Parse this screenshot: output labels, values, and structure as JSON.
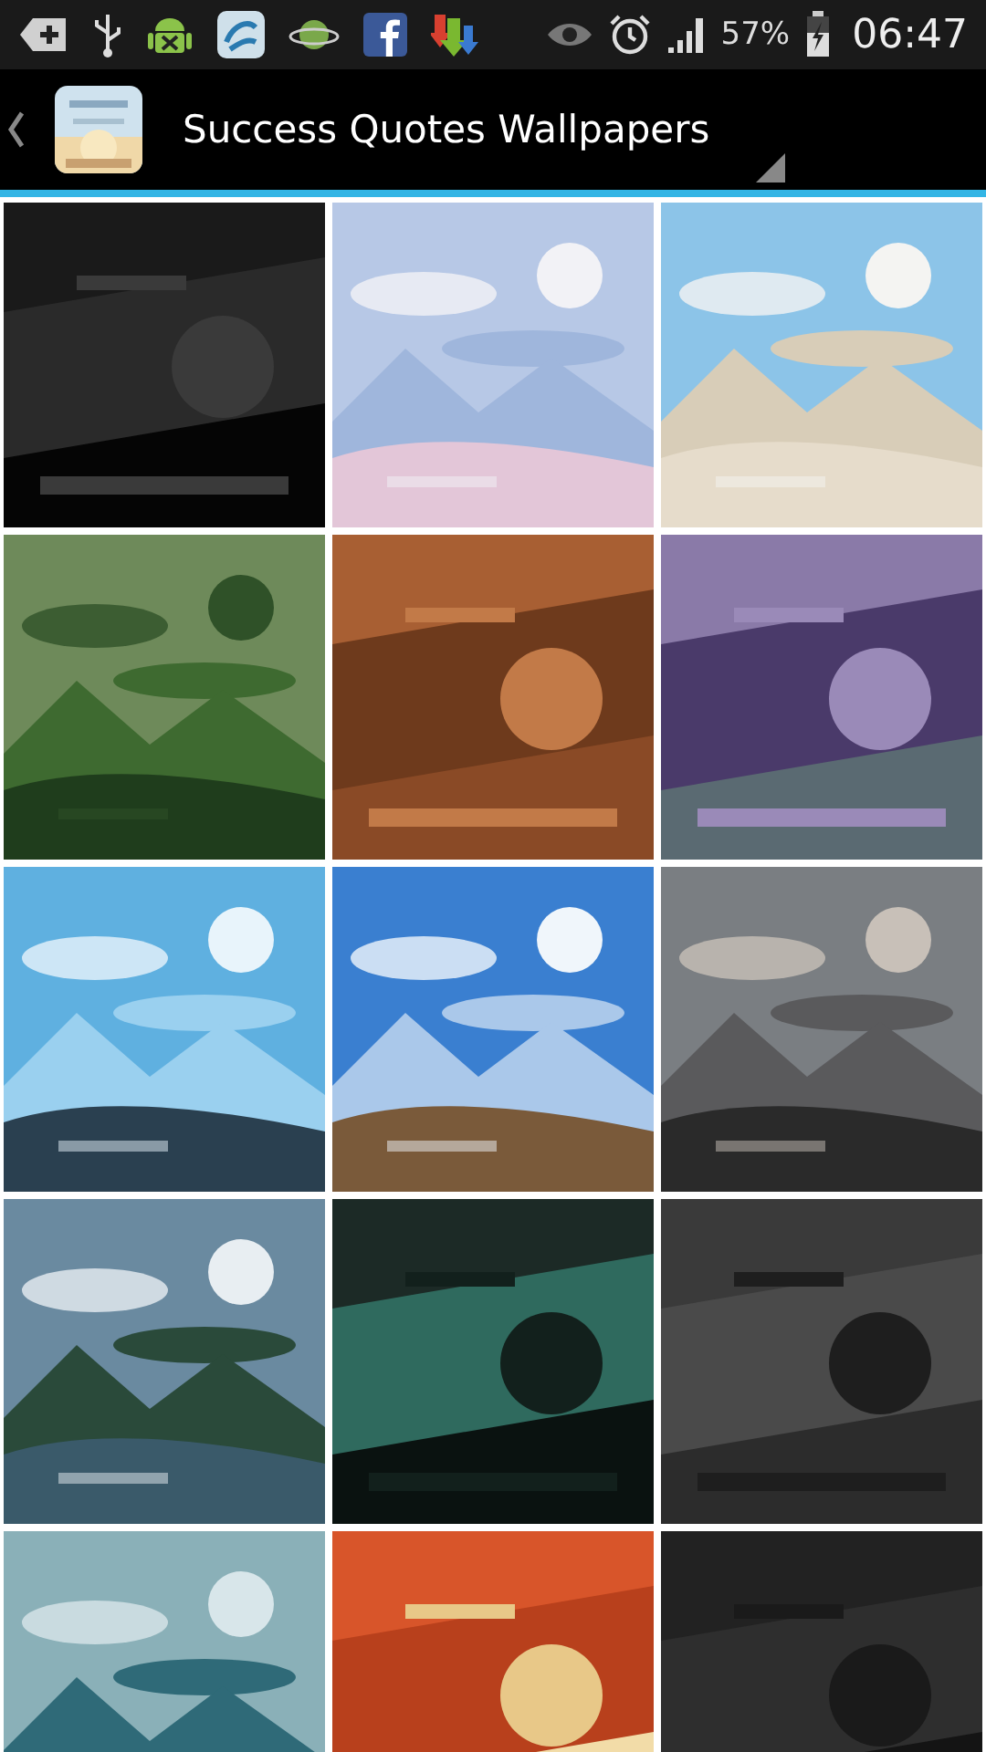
{
  "status_bar": {
    "battery": "57%",
    "time": "06:47"
  },
  "app_bar": {
    "title": "Success Quotes Wallpapers"
  }
}
